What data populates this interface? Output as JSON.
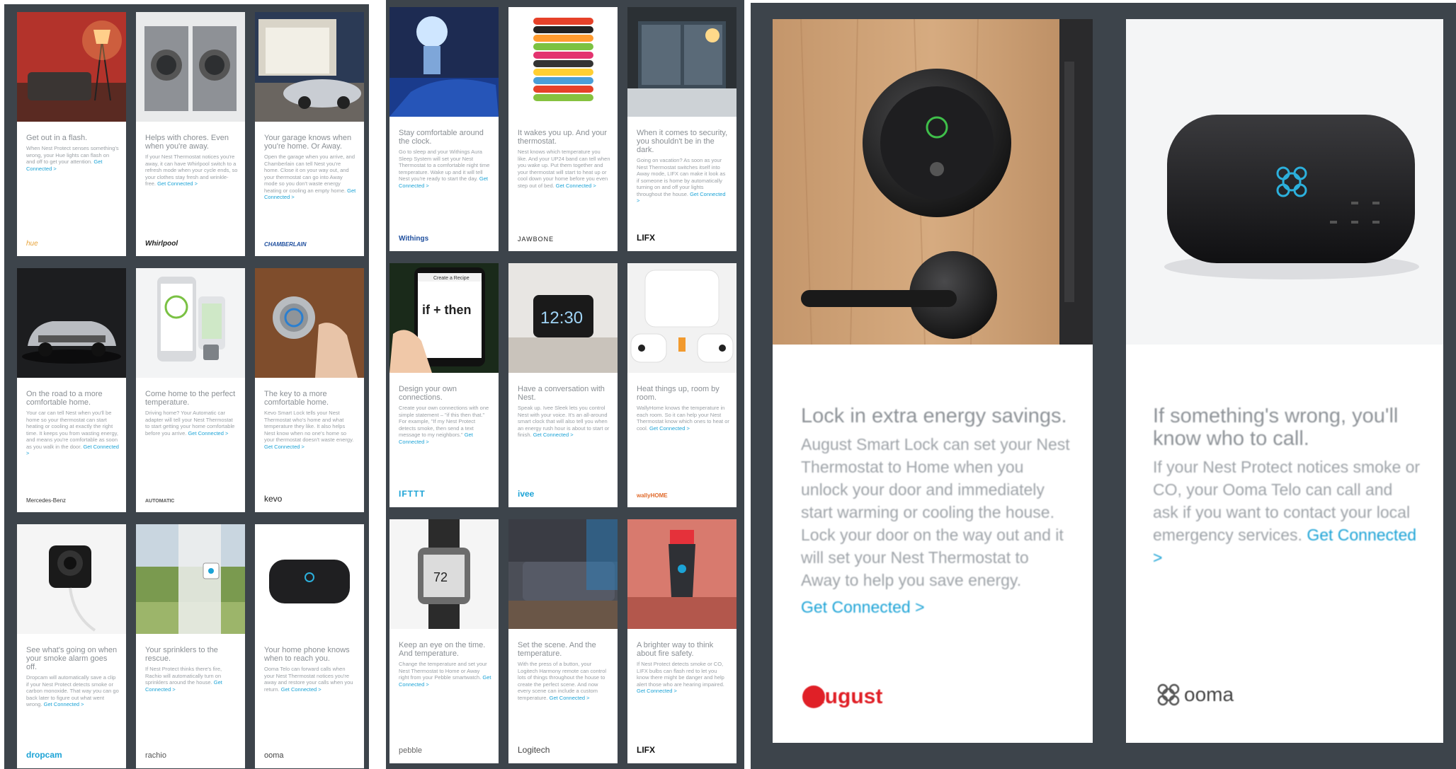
{
  "grid_a": [
    {
      "title": "Get out in a flash.",
      "body": "When Nest Protect senses something's wrong, your Hue lights can flash on and off to get your attention.",
      "cta": "Get Connected >",
      "logo": "hue",
      "scene": "lamp"
    },
    {
      "title": "Helps with chores. Even when you're away.",
      "body": "If your Nest Thermostat notices you're away, it can have Whirlpool switch to a refresh mode when your cycle ends, so your clothes stay fresh and wrinkle-free.",
      "cta": "Get Connected >",
      "logo": "Whirlpool",
      "scene": "washer"
    },
    {
      "title": "Your garage knows when you're home. Or Away.",
      "body": "Open the garage when you arrive, and Chamberlain can tell Nest you're home. Close it on your way out, and your thermostat can go into Away mode so you don't waste energy heating or cooling an empty home.",
      "cta": "Get Connected >",
      "logo": "CHAMBERLAIN",
      "scene": "garage"
    },
    {
      "title": "On the road to a more comfortable home.",
      "body": "Your car can tell Nest when you'll be home so your thermostat can start heating or cooling at exactly the right time. It keeps you from wasting energy, and means you're comfortable as soon as you walk in the door.",
      "cta": "Get Connected >",
      "logo": "Mercedes-Benz",
      "scene": "car"
    },
    {
      "title": "Come home to the perfect temperature.",
      "body": "Driving home? Your Automatic car adapter will tell your Nest Thermostat to start getting your home comfortable before you arrive.",
      "cta": "Get Connected >",
      "logo": "AUTOMATIC",
      "scene": "phone"
    },
    {
      "title": "The key to a more comfortable home.",
      "body": "Kevo Smart Lock tells your Nest Thermostat who's home and what temperature they like. It also helps Nest know when no one's home so your thermostat doesn't waste energy.",
      "cta": "Get Connected >",
      "logo": "kevo",
      "scene": "kevo"
    },
    {
      "title": "See what's going on when your smoke alarm goes off.",
      "body": "Dropcam will automatically save a clip if your Nest Protect detects smoke or carbon monoxide. That way you can go back later to figure out what went wrong.",
      "cta": "Get Connected >",
      "logo": "dropcam",
      "scene": "camera"
    },
    {
      "title": "Your sprinklers to the rescue.",
      "body": "If Nest Protect thinks there's fire, Rachio will automatically turn on sprinklers around the house.",
      "cta": "Get Connected >",
      "logo": "rachio",
      "scene": "sprinkler"
    },
    {
      "title": "Your home phone knows when to reach you.",
      "body": "Ooma Telo can forward calls when your Nest Thermostat notices you're away and restore your calls when you return.",
      "cta": "Get Connected >",
      "logo": "ooma",
      "scene": "ooma"
    }
  ],
  "grid_b": [
    {
      "title": "Stay comfortable around the clock.",
      "body": "Go to sleep and your Withings Aura Sleep System will set your Nest Thermostat to a comfortable night time temperature. Wake up and it will tell Nest you're ready to start the day.",
      "cta": "Get Connected >",
      "logo": "Withings",
      "scene": "bed"
    },
    {
      "title": "It wakes you up. And your thermostat.",
      "body": "Nest knows which temperature you like. And your UP24 band can tell when you wake up. Put them together and your thermostat will start to heat up or cool down your home before you even step out of bed.",
      "cta": "Get Connected >",
      "logo": "JAWBONE",
      "scene": "bands"
    },
    {
      "title": "When it comes to security, you shouldn't be in the dark.",
      "body": "Going on vacation? As soon as your Nest Thermostat switches itself into Away mode, LIFX can make it look as if someone is home by automatically turning on and off your lights throughout the house.",
      "cta": "Get Connected >",
      "logo": "LIFX",
      "scene": "window"
    },
    {
      "title": "Design your own connections.",
      "body": "Create your own connections with one simple statement – \"if this then that.\" For example, \"If my Nest Protect detects smoke, then send a text message to my neighbors.\"",
      "cta": "Get Connected >",
      "logo": "IFTTT",
      "scene": "ifttt",
      "ifttt_header": "Create a Recipe",
      "ifttt_big": "if + then"
    },
    {
      "title": "Have a conversation with Nest.",
      "body": "Speak up. Ivee Sleek lets you control Nest with your voice. It's an all-around smart clock that will also tell you when an energy rush hour is about to start or finish.",
      "cta": "Get Connected >",
      "logo": "ivee",
      "scene": "clock",
      "clock_time": "12:30"
    },
    {
      "title": "Heat things up, room by room.",
      "body": "WallyHome knows the temperature in each room. So it can help your Nest Thermostat know which ones to heat or cool.",
      "cta": "Get Connected >",
      "logo": "wallyHOME",
      "scene": "wally"
    },
    {
      "title": "Keep an eye on the time. And temperature.",
      "body": "Change the temperature and set your Nest Thermostat to Home or Away right from your Pebble smartwatch.",
      "cta": "Get Connected >",
      "logo": "pebble",
      "scene": "watch",
      "watch_temp": "72"
    },
    {
      "title": "Set the scene. And the temperature.",
      "body": "With the press of a button, your Logitech Harmony remote can control lots of things throughout the house to create the perfect scene. And now every scene can include a custom temperature.",
      "cta": "Get Connected >",
      "logo": "Logitech",
      "scene": "sofa"
    },
    {
      "title": "A brighter way to think about fire safety.",
      "body": "If Nest Protect detects smoke or CO, LIFX bulbs can flash red to let you know there might be danger and help alert those who are hearing impaired.",
      "cta": "Get Connected >",
      "logo": "LIFX",
      "scene": "bulb"
    }
  ],
  "big_cards": [
    {
      "title": "Lock in extra energy savings.",
      "body": "August Smart Lock can set your Nest Thermostat to Home when you unlock your door and immediately start warming or cooling the house. Lock your door on the way out and it will set your Nest Thermostat to Away to help you save energy.",
      "cta": "Get Connected >",
      "logo": "August",
      "scene": "august"
    },
    {
      "title": "If something's wrong, you'll know who to call.",
      "body": "If your Nest Protect notices smoke or CO, your Ooma Telo can call and ask if you want to contact your local emergency services.",
      "cta": "Get Connected >",
      "logo": "ooma",
      "scene": "ooma-big"
    }
  ],
  "colors": {
    "panel": "#3d444b",
    "accent": "#1ca3d6"
  }
}
